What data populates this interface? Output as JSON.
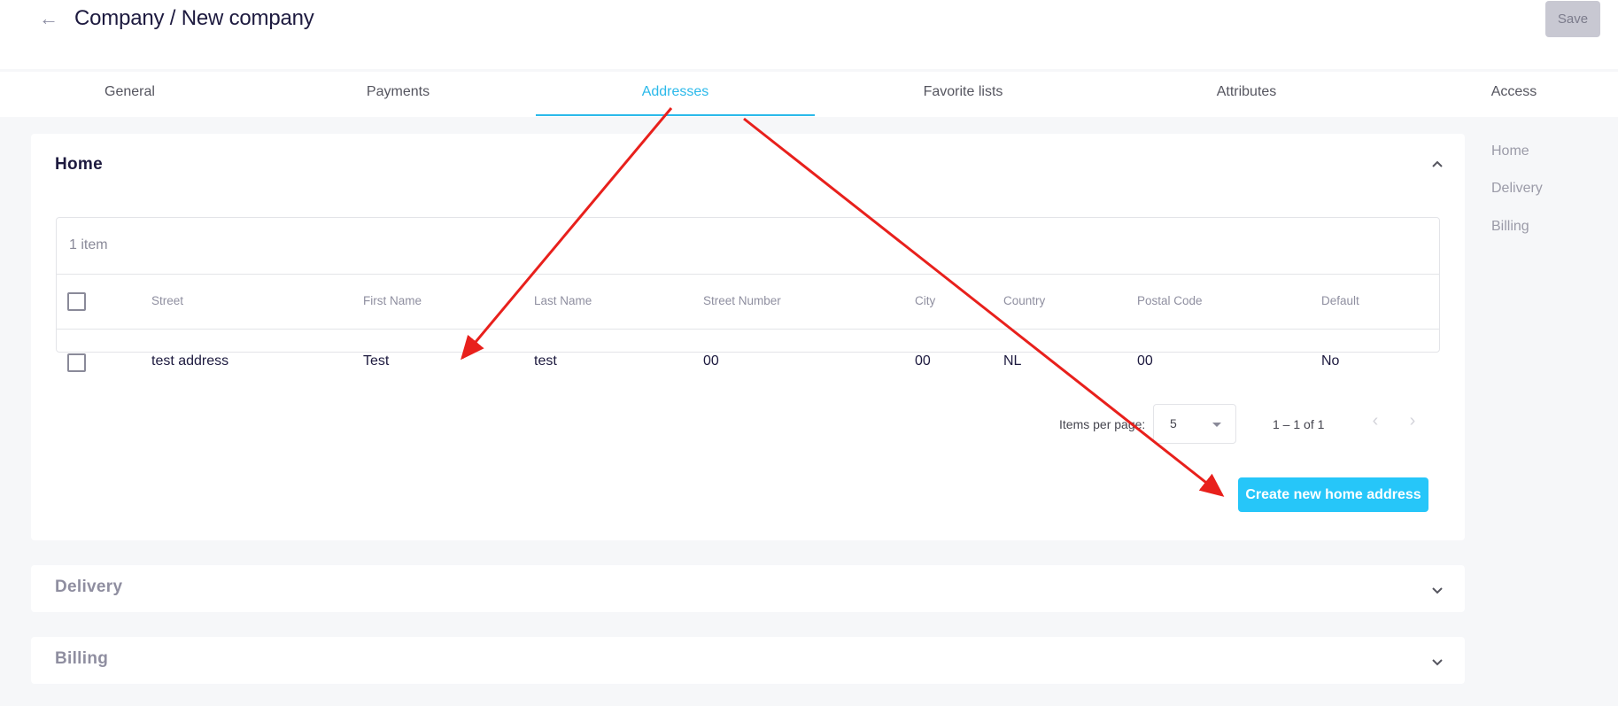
{
  "header": {
    "back_icon": "arrow-left-icon",
    "title": "Company / New company",
    "save_label": "Save"
  },
  "tabs": [
    {
      "label": "General",
      "active": false
    },
    {
      "label": "Payments",
      "active": false
    },
    {
      "label": "Addresses",
      "active": true
    },
    {
      "label": "Favorite lists",
      "active": false
    },
    {
      "label": "Attributes",
      "active": false
    },
    {
      "label": "Access",
      "active": false
    }
  ],
  "sections": {
    "home": {
      "title": "Home",
      "expanded": true,
      "toggle_icon": "chevron-up-icon",
      "table": {
        "count_label": "1 item",
        "columns": [
          "Street",
          "First Name",
          "Last Name",
          "Street Number",
          "City",
          "Country",
          "Postal Code",
          "Default"
        ],
        "rows": [
          [
            "test address",
            "Test",
            "test",
            "00",
            "00",
            "NL",
            "00",
            "No"
          ]
        ]
      },
      "paginator": {
        "items_per_page_label": "Items per page:",
        "items_per_page_value": "5",
        "range_label": "1 – 1 of 1",
        "prev_icon": "chevron-left-icon",
        "next_icon": "chevron-right-icon"
      },
      "create_button_label": "Create new home address"
    },
    "delivery": {
      "title": "Delivery",
      "expanded": false,
      "toggle_icon": "chevron-down-icon"
    },
    "billing": {
      "title": "Billing",
      "expanded": false,
      "toggle_icon": "chevron-down-icon"
    }
  },
  "side_nav": [
    "Home",
    "Delivery",
    "Billing"
  ],
  "colors": {
    "accent": "#2bb9ea",
    "primary_button": "#26c6f9",
    "annotation": "#e8201c",
    "disabled_button": "#c8c8d2"
  }
}
